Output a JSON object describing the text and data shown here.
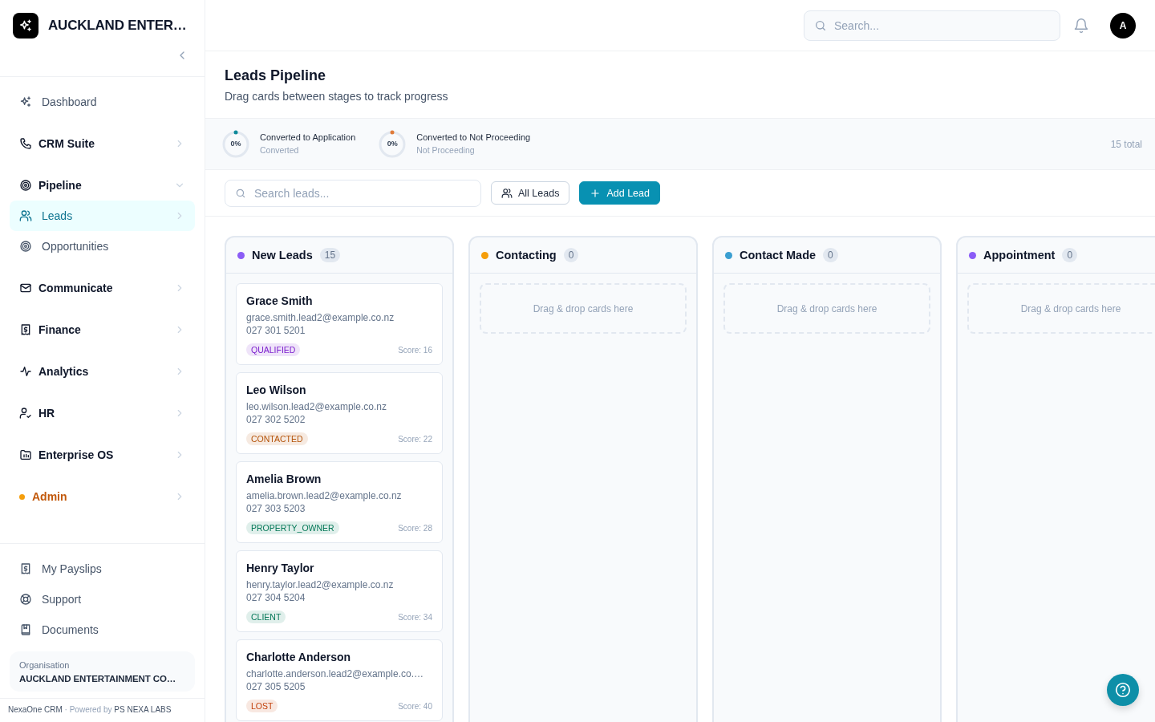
{
  "sidebar": {
    "brand": "AUCKLAND ENTER…",
    "nav": [
      {
        "kind": "link",
        "label": "Dashboard",
        "selected": false
      },
      {
        "kind": "group",
        "label": "CRM Suite",
        "expanded": false
      },
      {
        "kind": "group",
        "label": "Pipeline",
        "expanded": true,
        "children": [
          {
            "label": "Leads",
            "selected": true
          },
          {
            "label": "Opportunities",
            "selected": false
          }
        ]
      },
      {
        "kind": "group",
        "label": "Communicate",
        "expanded": false
      },
      {
        "kind": "group",
        "label": "Finance",
        "expanded": false
      },
      {
        "kind": "group",
        "label": "Analytics",
        "expanded": false
      },
      {
        "kind": "group",
        "label": "HR",
        "expanded": false
      },
      {
        "kind": "group",
        "label": "Enterprise OS",
        "expanded": false
      },
      {
        "kind": "alert",
        "label": "Admin",
        "expanded": false,
        "color": "#f59e0b"
      }
    ],
    "footer_links": [
      "My Payslips",
      "Support",
      "Documents"
    ],
    "organisation": {
      "label": "Organisation",
      "name": "AUCKLAND ENTERTAINMENT CO…"
    },
    "credit": {
      "product": "NexaOne CRM",
      "separator": "·",
      "powered_by": "Powered by",
      "company": "PS NEXA LABS"
    }
  },
  "topbar": {
    "search": {
      "placeholder": "Search..."
    },
    "avatar": "A"
  },
  "header": {
    "title": "Leads Pipeline",
    "subtitle": "Drag cards between stages to track progress"
  },
  "stats": {
    "items": [
      {
        "percent": "0%",
        "color": "#0e8a9a",
        "label": "Converted to Application",
        "sublabel": "Converted"
      },
      {
        "percent": "0%",
        "color": "#e07b39",
        "label": "Converted to Not Proceeding",
        "sublabel": "Not Proceeding"
      }
    ],
    "total": "15 total"
  },
  "toolbar": {
    "search": {
      "placeholder": "Search leads..."
    },
    "buttons": [
      {
        "kind": "outline",
        "label": "All Leads"
      },
      {
        "kind": "primary",
        "label": "Add Lead"
      }
    ]
  },
  "board": {
    "columns": [
      {
        "title": "New Leads",
        "color": "#8b5cf6",
        "count": "15",
        "cards": [
          {
            "name": "Grace Smith",
            "email": "grace.smith.lead2@example.co.nz",
            "phone": "027 301 5201",
            "tag": {
              "label": "QUALIFIED",
              "color": "#7e22ce"
            },
            "score": "Score: 16"
          },
          {
            "name": "Leo Wilson",
            "email": "leo.wilson.lead2@example.co.nz",
            "phone": "027 302 5202",
            "tag": {
              "label": "CONTACTED",
              "color": "#b45309"
            },
            "score": "Score: 22"
          },
          {
            "name": "Amelia Brown",
            "email": "amelia.brown.lead2@example.co.nz",
            "phone": "027 303 5203",
            "tag": {
              "label": "PROPERTY_OWNER",
              "color": "#047857"
            },
            "score": "Score: 28"
          },
          {
            "name": "Henry Taylor",
            "email": "henry.taylor.lead2@example.co.nz",
            "phone": "027 304 5204",
            "tag": {
              "label": "CLIENT",
              "color": "#047858"
            },
            "score": "Score: 34"
          },
          {
            "name": "Charlotte Anderson",
            "email": "charlotte.anderson.lead2@example.co.…",
            "phone": "027 305 5205",
            "tag": {
              "label": "LOST",
              "color": "#c2410c"
            },
            "score": "Score: 40"
          }
        ]
      },
      {
        "title": "Contacting",
        "color": "#f59e0b",
        "count": "0",
        "empty_text": "Drag & drop cards here"
      },
      {
        "title": "Contact Made",
        "color": "#3b9fd1",
        "count": "0",
        "empty_text": "Drag & drop cards here"
      },
      {
        "title": "Appointment",
        "color": "#8b5cf7",
        "count": "0",
        "empty_text": "Drag & drop cards here"
      }
    ]
  }
}
